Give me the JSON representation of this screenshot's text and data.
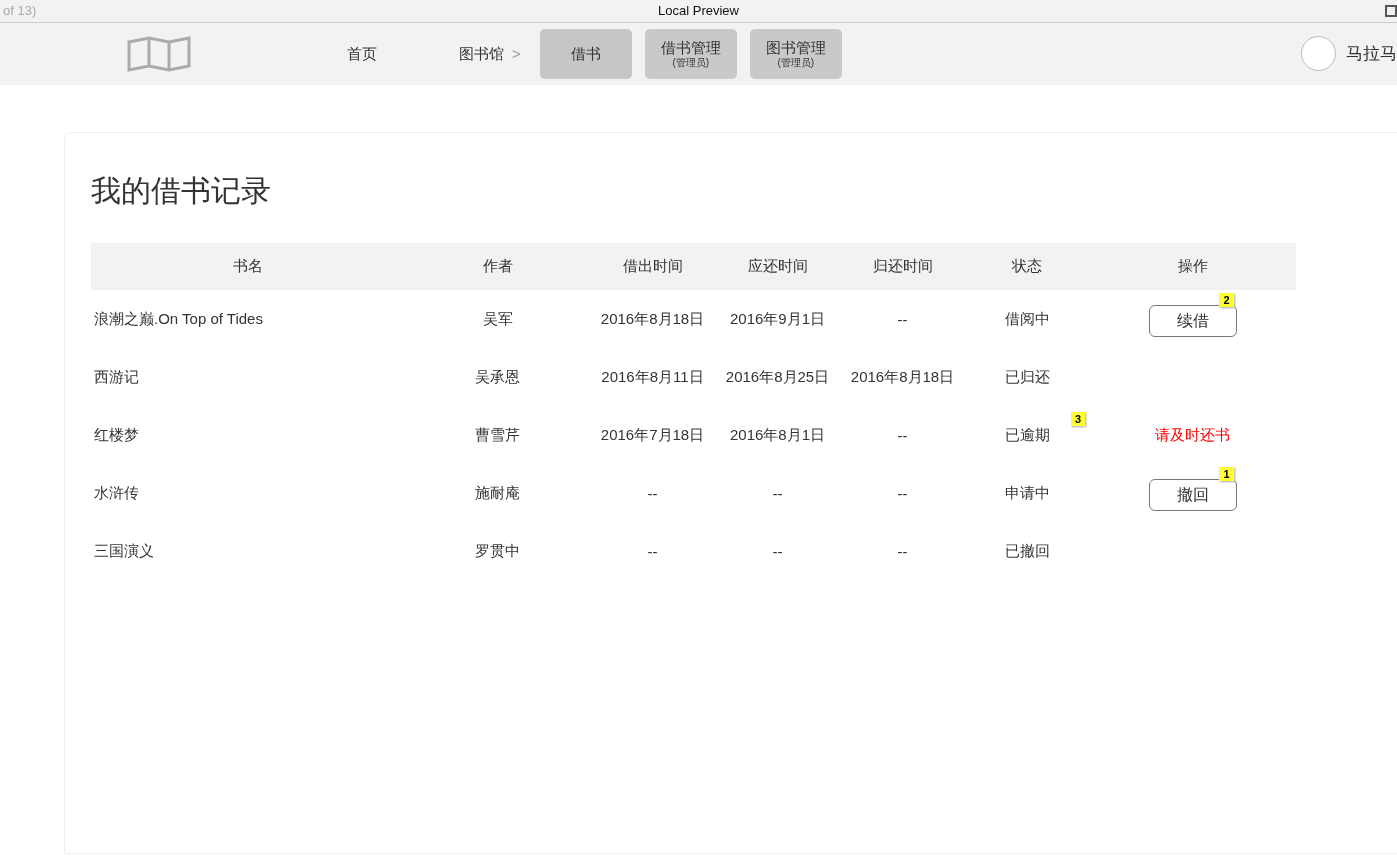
{
  "window": {
    "page_counter": "of 13)",
    "title": "Local Preview"
  },
  "nav": {
    "items": [
      {
        "label": "首页",
        "selected": false
      },
      {
        "label": "图书馆",
        "chevron": ">",
        "selected": false
      },
      {
        "label": "借书",
        "selected": true
      },
      {
        "label": "借书管理",
        "sub": "(管理员)",
        "selected": false
      },
      {
        "label": "图书管理",
        "sub": "(管理员)",
        "selected": false
      }
    ],
    "user": "马拉马"
  },
  "page_title": "我的借书记录",
  "table": {
    "columns": [
      "书名",
      "作者",
      "借出时间",
      "应还时间",
      "归还时间",
      "状态",
      "操作"
    ],
    "rows": [
      {
        "cells": [
          "浪潮之巅.On Top of Tides",
          "吴军",
          "2016年8月18日",
          "2016年9月1日",
          "--",
          "借阅中"
        ],
        "action": {
          "kind": "button",
          "text": "续借",
          "note": "2"
        }
      },
      {
        "cells": [
          "西游记",
          "吴承恩",
          "2016年8月11日",
          "2016年8月25日",
          "2016年8月18日",
          "已归还"
        ],
        "action": {
          "kind": "none"
        }
      },
      {
        "cells": [
          "红楼梦",
          "曹雪芹",
          "2016年7月18日",
          "2016年8月1日",
          "--",
          "已逾期"
        ],
        "status_note": "3",
        "action": {
          "kind": "warning",
          "text": "请及时还书"
        }
      },
      {
        "cells": [
          "水浒传",
          "施耐庵",
          "--",
          "--",
          "--",
          "申请中"
        ],
        "action": {
          "kind": "button",
          "text": "撤回",
          "note": "1"
        }
      },
      {
        "cells": [
          "三国演义",
          "罗贯中",
          "--",
          "--",
          "--",
          "已撤回"
        ],
        "action": {
          "kind": "none"
        }
      }
    ]
  }
}
